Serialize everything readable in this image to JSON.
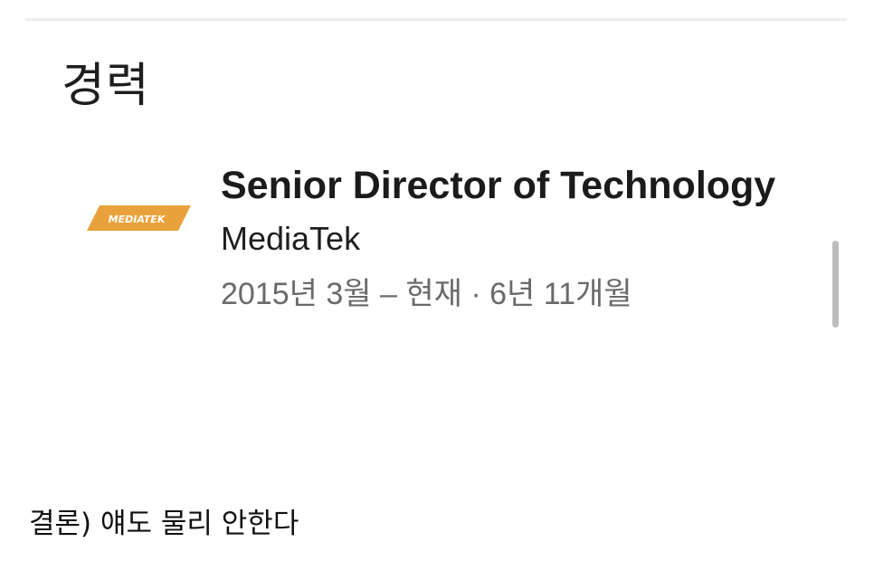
{
  "section": {
    "title": "경력"
  },
  "experience": {
    "title": "Senior Director of Technology",
    "company": "MediaTek",
    "date_range": "2015년 3월 – 현재 · 6년 11개월",
    "logo": {
      "text": "MEDIATEK",
      "color": "#E9A23B",
      "icon": "mediatek-logo"
    }
  },
  "caption": "결론) 얘도 물리 안한다",
  "colors": {
    "text_primary": "#1b1b1b",
    "text_secondary": "#6a6a6a",
    "logo_orange": "#E9A23B",
    "scrollbar": "#bdbdbd"
  }
}
